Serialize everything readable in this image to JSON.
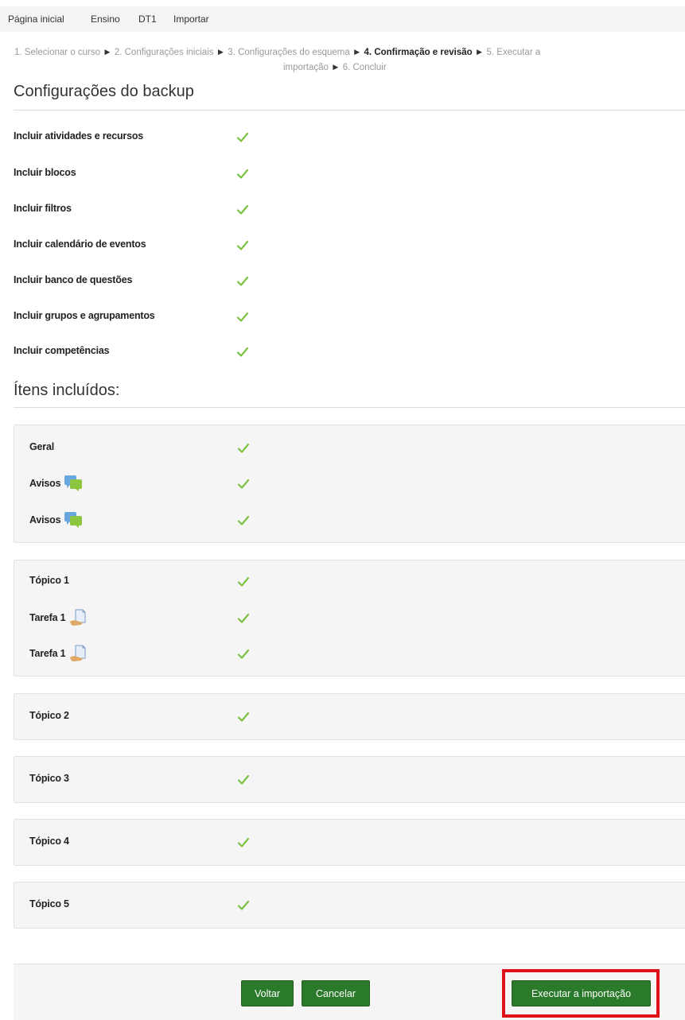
{
  "navbar": {
    "items": [
      "Página inicial",
      "Ensino",
      "DT1",
      "Importar"
    ]
  },
  "progress": {
    "step1": "1. Selecionar o curso",
    "step2": "2. Configurações iniciais",
    "step3": "3. Configurações do esquema",
    "step4": "4. Confirmação e revisão",
    "step5a": "5. Executar a",
    "step5b": "importação",
    "step6": "6. Concluir",
    "separator": "►"
  },
  "backup_settings": {
    "title": "Configurações do backup",
    "items": [
      {
        "label": "Incluir atividades e recursos",
        "included": true
      },
      {
        "label": "Incluir blocos",
        "included": true
      },
      {
        "label": "Incluir filtros",
        "included": true
      },
      {
        "label": "Incluir calendário de eventos",
        "included": true
      },
      {
        "label": "Incluir banco de questões",
        "included": true
      },
      {
        "label": "Incluir grupos e agrupamentos",
        "included": true
      },
      {
        "label": "Incluir competências",
        "included": true
      }
    ]
  },
  "included_items": {
    "title": "Ítens incluídos:",
    "sections": [
      {
        "items": [
          {
            "label": "Geral",
            "icon": null
          },
          {
            "label": "Avisos",
            "icon": "forum-icon"
          },
          {
            "label": "Avisos",
            "icon": "forum-icon"
          }
        ]
      },
      {
        "items": [
          {
            "label": "Tópico 1",
            "icon": null
          },
          {
            "label": "Tarefa 1",
            "icon": "assignment-icon"
          },
          {
            "label": "Tarefa 1",
            "icon": "assignment-icon"
          }
        ]
      },
      {
        "items": [
          {
            "label": "Tópico 2",
            "icon": null
          }
        ]
      },
      {
        "items": [
          {
            "label": "Tópico 3",
            "icon": null
          }
        ]
      },
      {
        "items": [
          {
            "label": "Tópico 4",
            "icon": null
          }
        ]
      },
      {
        "items": [
          {
            "label": "Tópico 5",
            "icon": null
          }
        ]
      }
    ]
  },
  "buttons": {
    "back": "Voltar",
    "cancel": "Cancelar",
    "perform_import": "Executar a importação"
  },
  "colors": {
    "check": "#7cc242",
    "button": "#2b7a2b",
    "highlight": "#e0101a"
  }
}
